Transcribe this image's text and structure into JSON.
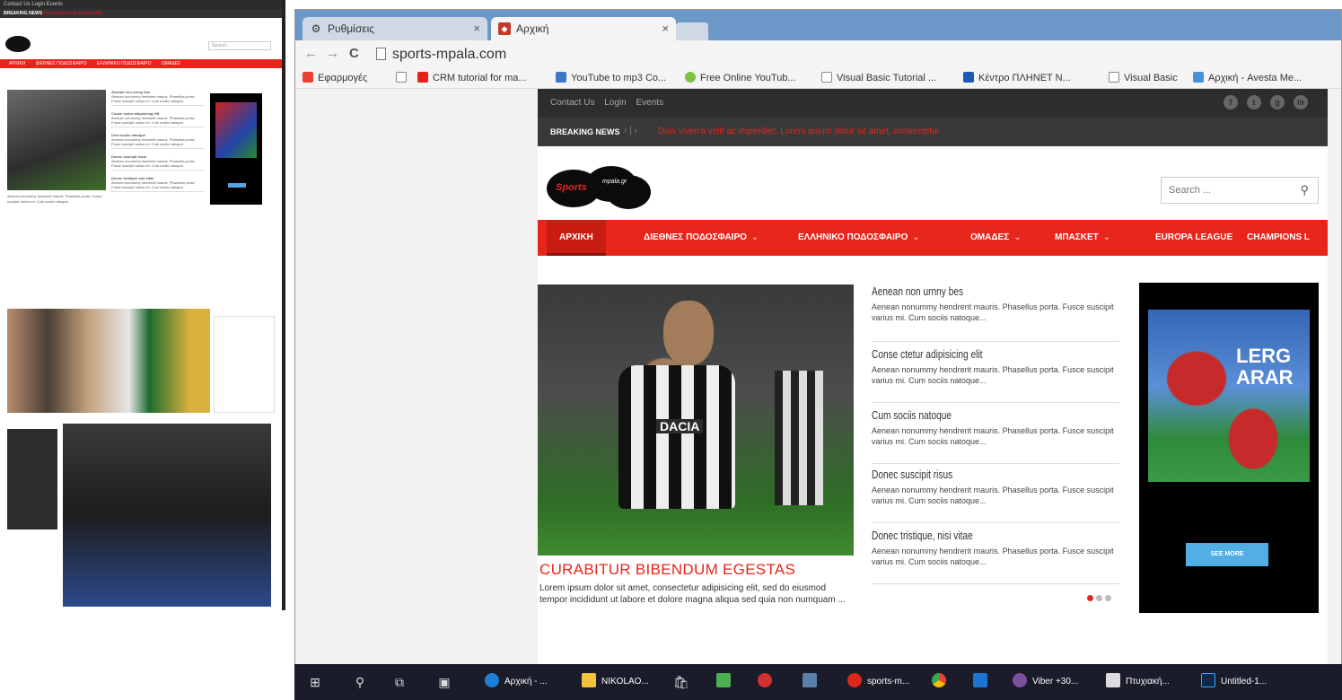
{
  "left_panel": {
    "top_links": "Contact Us  Login  Events",
    "breaking_label": "BREAKING NEWS",
    "breaking_text": "Duis viverra velit ac imperdiet",
    "search_placeholder": "Search...",
    "menu": [
      "ΑΡΧΙΚΗ",
      "ΔΙΕΘΝΕΣ ΠΟΔΟΣΦΑΙΡΟ",
      "ΕΛΛΗΝΙΚΟ ΠΟΔΟΣΦΑΙΡΟ",
      "ΟΜΑΔΕΣ"
    ],
    "body_text": "Aenean nonummy hendrerit mauris. Phasellus porta. Fusce suscipit varius mi. Cum sociis natoque.",
    "list_items": [
      "Aenean non urnny bes",
      "Conse ctetur adipisicing elit",
      "Cum sociis natoque",
      "Donec suscipit risus",
      "Donec tristique nisi vitae"
    ]
  },
  "browser": {
    "tabs": [
      {
        "label": "Ρυθμίσεις",
        "icon": "gear-icon"
      },
      {
        "label": "Αρχική",
        "icon": "site-favicon"
      }
    ],
    "url": "sports-mpala.com",
    "bookmarks": [
      {
        "label": "Εφαρμογές",
        "color": "#e94235"
      },
      {
        "label": "",
        "color": "#ffffff"
      },
      {
        "label": "CRM tutorial for ma...",
        "color": "#e62117"
      },
      {
        "label": "YouTube to mp3 Co...",
        "color": "#3b78c4"
      },
      {
        "label": "Free Online YouTub...",
        "color": "#7cc242"
      },
      {
        "label": "Visual Basic Tutorial ...",
        "color": "#ffffff"
      },
      {
        "label": "Κέντρο ΠΛΗΝΕΤ Ν...",
        "color": "#1c5bb5"
      },
      {
        "label": "Visual Basic",
        "color": "#ffffff"
      },
      {
        "label": "Αρχική - Avesta Me...",
        "color": "#4a90d9"
      }
    ]
  },
  "site": {
    "top_links": [
      "Contact Us",
      "Login",
      "Events"
    ],
    "social": [
      "f",
      "t",
      "g",
      "in"
    ],
    "breaking_label": "BREAKING NEWS",
    "breaking_arrows": "‹ | ›",
    "breaking_text": "Duis viverra velit ac imperdiet. Lorem ipsum dolor sit amet, consectetur",
    "logo_main": "Sports",
    "logo_sub": "mpala.gr",
    "search_placeholder": "Search ...",
    "menu": [
      {
        "label": "ΑΡΧΙΚΗ",
        "caret": ""
      },
      {
        "label": "ΔΙΕΘΝΕΣ ΠΟΔΟΣΦΑΙΡΟ",
        "caret": "⌄"
      },
      {
        "label": "ΕΛΛΗΝΙΚΟ ΠΟΔΟΣΦΑΙΡΟ",
        "caret": "⌄"
      },
      {
        "label": "ΟΜΑΔΕΣ",
        "caret": "⌄"
      },
      {
        "label": "ΜΠΑΣΚΕΤ",
        "caret": "⌄"
      },
      {
        "label": "EUROPA LEAGUE",
        "caret": ""
      },
      {
        "label": "CHAMPIONS L",
        "caret": ""
      }
    ],
    "hero": {
      "sponsor": "DACIA",
      "title": "CURABITUR BIBENDUM EGESTAS",
      "desc": "Lorem ipsum dolor sit amet, consectetur adipisicing elit, sed do eiusmod tempor incididunt ut labore et dolore magna aliqua sed quia non numquam ..."
    },
    "list": [
      {
        "title": "Aenean non urnny bes",
        "desc": "Aenean nonummy hendrerit mauris. Phasellus porta. Fusce suscipit varius mi. Cum sociis natoque..."
      },
      {
        "title": "Conse ctetur adipisicing elit",
        "desc": "Aenean nonummy hendrerit mauris. Phasellus porta. Fusce suscipit varius mi. Cum sociis natoque..."
      },
      {
        "title": "Cum sociis natoque",
        "desc": "Aenean nonummy hendrerit mauris. Phasellus porta. Fusce suscipit varius mi. Cum sociis natoque..."
      },
      {
        "title": "Donec suscipit risus",
        "desc": "Aenean nonummy hendrerit mauris. Phasellus porta. Fusce suscipit varius mi. Cum sociis natoque..."
      },
      {
        "title": "Donec tristique, nisi vitae",
        "desc": "Aenean nonummy hendrerit mauris. Phasellus porta. Fusce suscipit varius mi. Cum sociis natoque..."
      }
    ],
    "ad": {
      "text": "LERG ARAR",
      "button": "SEE MORE"
    },
    "colors": {
      "accent": "#e8251b",
      "dark": "#2d2d2d",
      "ad_button": "#53aee6"
    }
  },
  "taskbar": {
    "start_icon": "windows-icon",
    "items": [
      {
        "label": "Αρχική - ...",
        "icon": "edge-icon"
      },
      {
        "label": "NIKOLAO...",
        "icon": "folder-icon"
      },
      {
        "label": "",
        "icon": "store-icon"
      },
      {
        "label": "",
        "icon": "app-icon"
      },
      {
        "label": "",
        "icon": "media-icon"
      },
      {
        "label": "",
        "icon": "photo-icon"
      },
      {
        "label": "sports-m...",
        "icon": "opera-icon"
      },
      {
        "label": "",
        "icon": "chrome-icon"
      },
      {
        "label": "",
        "icon": "play-icon"
      },
      {
        "label": "Viber +30...",
        "icon": "viber-icon"
      },
      {
        "label": "Πτυχιακή...",
        "icon": "document-icon"
      },
      {
        "label": "Untitled-1...",
        "icon": "photoshop-icon"
      }
    ]
  }
}
